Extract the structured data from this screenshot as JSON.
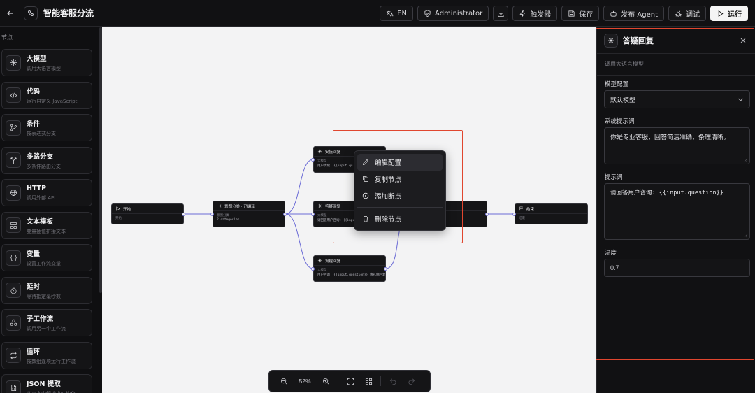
{
  "header": {
    "title": "智能客服分流",
    "buttons": {
      "language": "EN",
      "role": "Administrator",
      "trigger": "触发器",
      "save": "保存",
      "publish": "发布 Agent",
      "debug": "调试",
      "run": "运行"
    }
  },
  "sidebar": {
    "heading": "节点",
    "items": [
      {
        "title": "大模型",
        "desc": "调用大语言模型",
        "icon": "sparkle-icon"
      },
      {
        "title": "代码",
        "desc": "运行自定义 JavaScript",
        "icon": "code-icon"
      },
      {
        "title": "条件",
        "desc": "按表达式分支",
        "icon": "branch-icon"
      },
      {
        "title": "多路分支",
        "desc": "多条件路由分支",
        "icon": "split-icon"
      },
      {
        "title": "HTTP",
        "desc": "调用外部 API",
        "icon": "globe-icon"
      },
      {
        "title": "文本模板",
        "desc": "变量插值拼接文本",
        "icon": "template-icon"
      },
      {
        "title": "变量",
        "desc": "设置工作流变量",
        "icon": "braces-icon"
      },
      {
        "title": "延时",
        "desc": "等待指定毫秒数",
        "icon": "timer-icon"
      },
      {
        "title": "子工作流",
        "desc": "调用另一个工作流",
        "icon": "subflow-icon"
      },
      {
        "title": "循环",
        "desc": "按数组逐项运行工作流",
        "icon": "loop-icon"
      },
      {
        "title": "JSON 提取",
        "desc": "从文本中解析出结构化",
        "icon": "json-icon"
      }
    ]
  },
  "canvas": {
    "nodes": {
      "start": {
        "title": "开始",
        "sub": "开始"
      },
      "classify": {
        "title": "意图分类 · 已编辑",
        "sub": "意图分类",
        "body": "2 categories"
      },
      "soothe": {
        "title": "安抚回复",
        "sub": "大模型",
        "body": "用户情绪: {{input.qu"
      },
      "answer": {
        "title": "答疑回复",
        "sub": "大模型",
        "body": "请回答用户咨询: {{inpu"
      },
      "complaint": {
        "title": "流程回复",
        "sub": "大模型",
        "body": "用户咨询: {{input.question}} 请礼貌回复..."
      },
      "end": {
        "title": "结束",
        "sub": "结束"
      }
    },
    "context_menu": {
      "edit": "编辑配置",
      "copy": "复制节点",
      "breakpoint": "添加断点",
      "delete": "删除节点"
    },
    "zoom": "52%",
    "accent": "#6b6bd6",
    "highlight": "#e0462f"
  },
  "panel": {
    "title": "答疑回复",
    "desc": "调用大语言模型",
    "model_label": "模型配置",
    "model_value": "默认模型",
    "system_label": "系统提示词",
    "system_value": "你是专业客服，回答简洁准确、条理清晰。",
    "prompt_label": "提示词",
    "prompt_value": "请回答用户咨询: {{input.question}}",
    "temp_label": "温度",
    "temp_value": "0.7"
  }
}
